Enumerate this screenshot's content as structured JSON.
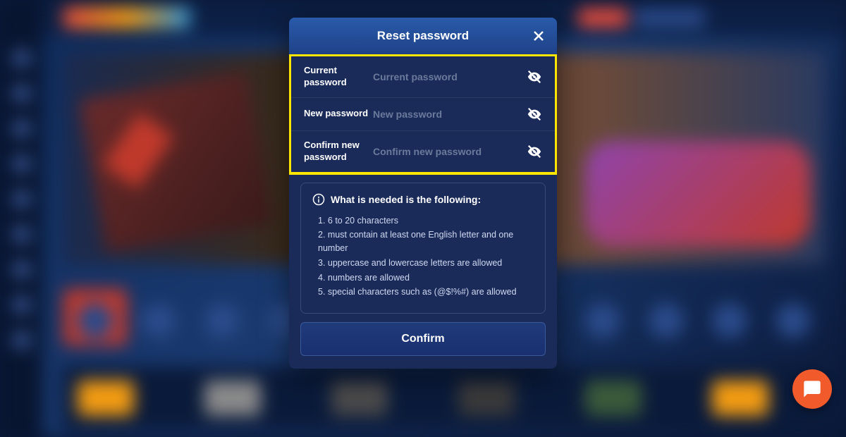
{
  "modal": {
    "title": "Reset password",
    "fields": {
      "current": {
        "label": "Current password",
        "placeholder": "Current password"
      },
      "new": {
        "label": "New password",
        "placeholder": "New password"
      },
      "confirm": {
        "label": "Confirm new password",
        "placeholder": "Confirm new password"
      }
    },
    "requirements": {
      "header": "What is needed is the following:",
      "items": [
        "1. 6 to 20 characters",
        "2. must contain at least one English letter and one number",
        "3. uppercase and lowercase letters are allowed",
        "4. numbers are allowed",
        "5. special characters such as (@$!%#) are allowed"
      ]
    },
    "confirm_label": "Confirm"
  }
}
